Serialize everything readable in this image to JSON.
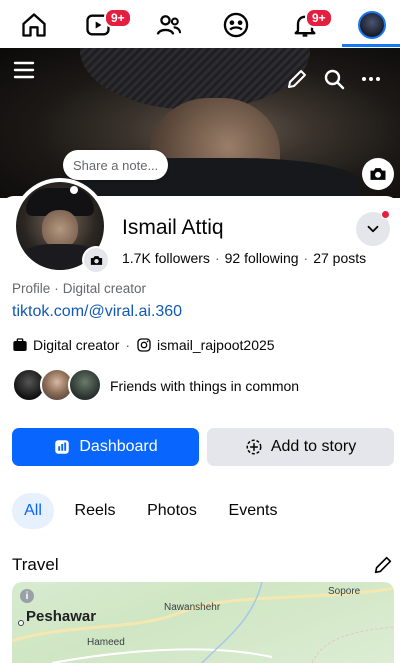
{
  "topnav": {
    "items": [
      {
        "name": "home",
        "badge": ""
      },
      {
        "name": "reels",
        "badge": "9+"
      },
      {
        "name": "friends",
        "badge": ""
      },
      {
        "name": "groups",
        "badge": ""
      },
      {
        "name": "notifications",
        "badge": "9+"
      },
      {
        "name": "profile",
        "badge": ""
      }
    ],
    "active": "profile"
  },
  "cover": {
    "note_placeholder": "Share a note..."
  },
  "profile": {
    "name": "Ismail Attiq",
    "followers": "1.7K followers",
    "following": "92 following",
    "posts": "27 posts",
    "sep": "·",
    "meta_label": "Profile",
    "meta_category": "Digital creator",
    "link": "tiktok.com/@viral.ai.360",
    "category_badge": "Digital creator",
    "instagram": "ismail_rajpoot2025",
    "friends_text": "Friends with things in common"
  },
  "buttons": {
    "dashboard": "Dashboard",
    "add_story": "Add to story"
  },
  "tabs": [
    {
      "label": "All",
      "active": true
    },
    {
      "label": "Reels",
      "active": false
    },
    {
      "label": "Photos",
      "active": false
    },
    {
      "label": "Events",
      "active": false
    }
  ],
  "section": {
    "title": "Travel"
  },
  "map": {
    "labels": [
      "Sopore",
      "Nawanshehr",
      "Peshawar",
      "Hameed"
    ]
  },
  "colors": {
    "accent": "#0866ff",
    "badge": "#e41e3f",
    "link": "#1259b5"
  },
  "icons": [
    "home-icon",
    "reels-icon",
    "friends-icon",
    "groups-icon",
    "bell-icon",
    "menu-icon",
    "pencil-icon",
    "search-icon",
    "more-icon",
    "camera-icon",
    "chevron-down-icon",
    "briefcase-icon",
    "instagram-icon",
    "dashboard-icon",
    "add-story-icon",
    "info-icon"
  ]
}
